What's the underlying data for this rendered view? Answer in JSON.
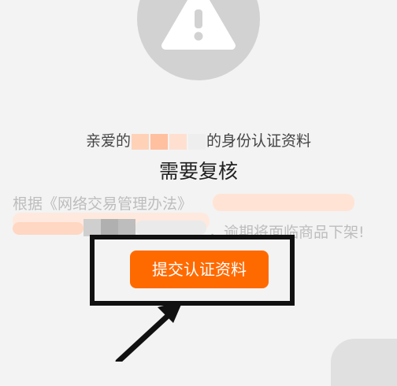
{
  "notice": {
    "greeting_prefix": "亲爱的",
    "greeting_suffix": "的身份认证资料",
    "headline": "需要复核",
    "legal_prefix": "根据《网络交易管理办法》",
    "legal_suffix": "，逾期将面临商品下架!"
  },
  "action": {
    "submit_label": "提交认证资料"
  },
  "colors": {
    "accent": "#ff6a00",
    "annotation": "#111111"
  },
  "icons": {
    "warning": "warning-triangle-icon",
    "annotation_arrow": "arrow-icon"
  }
}
